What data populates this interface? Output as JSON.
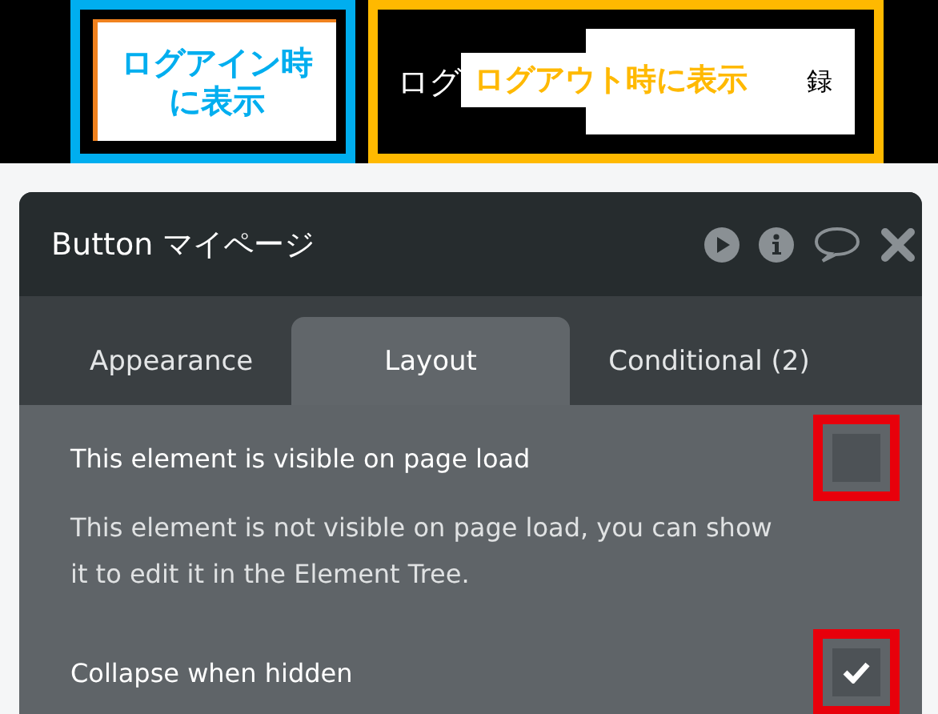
{
  "header_strip": {
    "login_label": {
      "text": "ログアイン時に表示",
      "color": "#00aeef"
    },
    "logout_area": {
      "behind_left": "ログ",
      "behind_right": "録",
      "label": {
        "text": "ログアウト時に表示",
        "color": "#ffb900"
      }
    }
  },
  "panel": {
    "title": "Button マイページ",
    "tabs": [
      {
        "label": "Appearance",
        "selected": false
      },
      {
        "label": "Layout",
        "selected": true
      },
      {
        "label": "Conditional (2)",
        "selected": false
      }
    ],
    "options": [
      {
        "label": "This element is visible on page load",
        "checked": false,
        "note": "This element is not visible on page load, you can show it to edit it in the Element Tree."
      },
      {
        "label": "Collapse when hidden",
        "checked": true
      }
    ]
  }
}
